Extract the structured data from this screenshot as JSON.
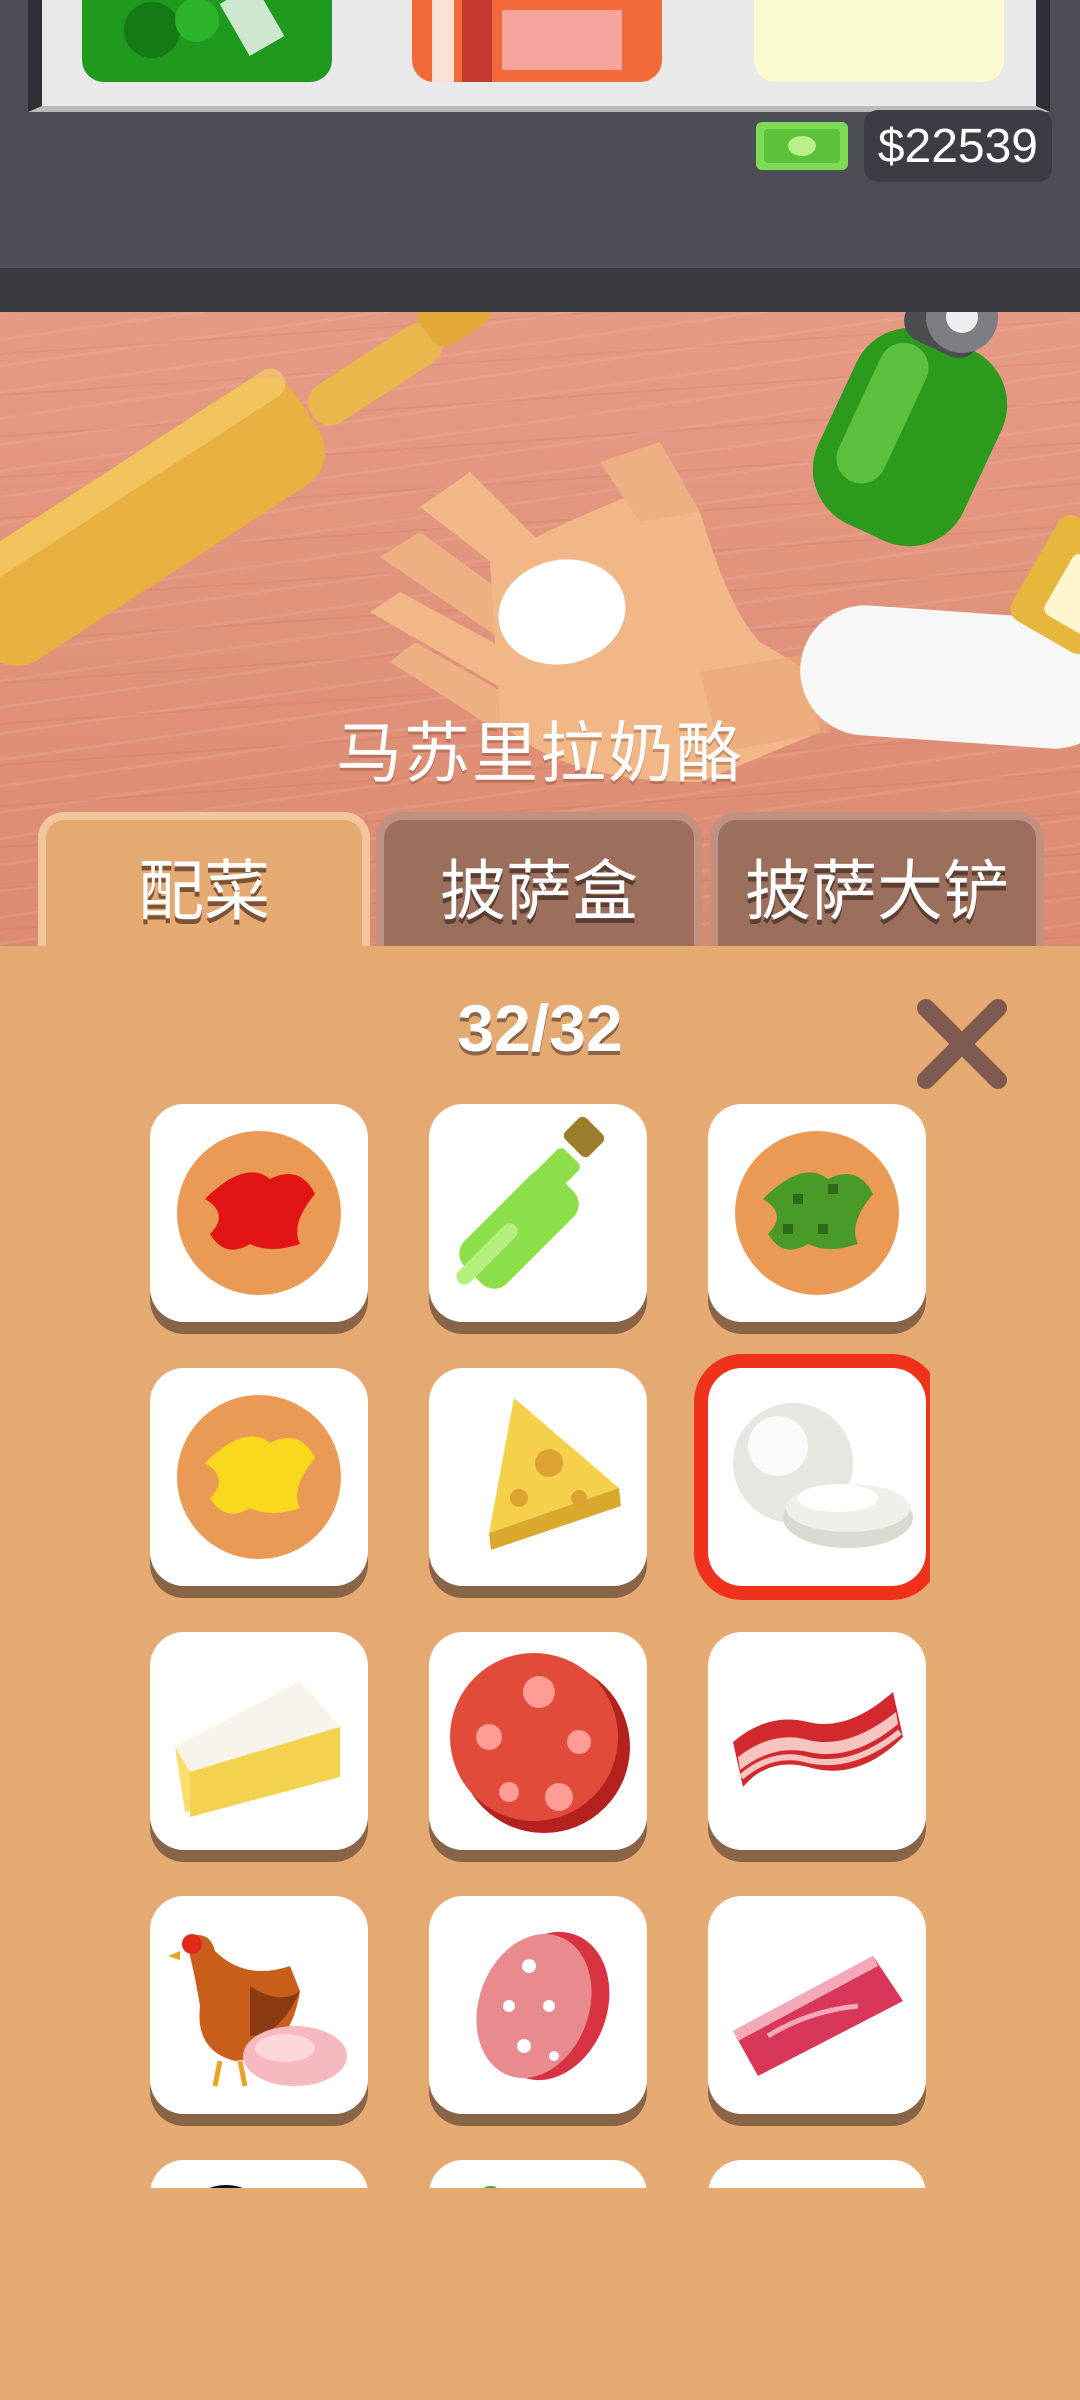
{
  "game": {
    "money": "$22539",
    "ingredient_name": "马苏里拉奶酪",
    "tabs": [
      {
        "label": "配菜",
        "active": true
      },
      {
        "label": "披萨盒",
        "active": false
      },
      {
        "label": "披萨大铲",
        "active": false
      }
    ],
    "counter": "32/32",
    "selected_index": 5,
    "items": [
      {
        "name": "tomato-sauce-icon"
      },
      {
        "name": "olive-oil-bottle-icon"
      },
      {
        "name": "pesto-sauce-icon"
      },
      {
        "name": "cheese-sauce-icon"
      },
      {
        "name": "cheese-wedge-icon"
      },
      {
        "name": "mozzarella-icon"
      },
      {
        "name": "brie-icon"
      },
      {
        "name": "pepperoni-icon"
      },
      {
        "name": "bacon-icon"
      },
      {
        "name": "chicken-icon"
      },
      {
        "name": "salami-icon"
      },
      {
        "name": "ham-icon"
      },
      {
        "name": "black-olive-icon"
      },
      {
        "name": "green-pepper-icon"
      },
      {
        "name": "spinach-icon"
      }
    ],
    "colors": {
      "accent": "#e5aa72",
      "selected": "#f0321d",
      "money_green": "#7ed957"
    }
  }
}
